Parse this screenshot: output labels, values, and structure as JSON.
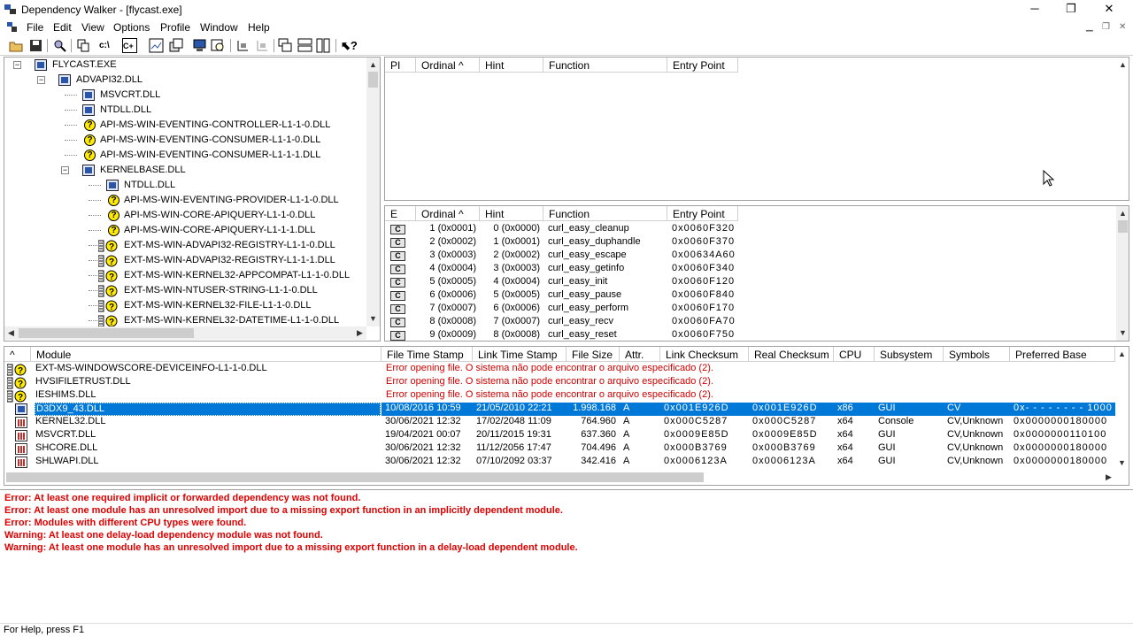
{
  "window": {
    "title": "Dependency Walker - [flycast.exe]",
    "minimize": "─",
    "maximize": "❐",
    "close": "✕"
  },
  "menu": [
    "File",
    "Edit",
    "View",
    "Options",
    "Profile",
    "Window",
    "Help"
  ],
  "tree": [
    {
      "label": "FLYCAST.EXE",
      "level": 0,
      "icon": "module-icon",
      "expander": "−"
    },
    {
      "label": "ADVAPI32.DLL",
      "level": 1,
      "icon": "module-icon",
      "expander": "−"
    },
    {
      "label": "MSVCRT.DLL",
      "level": 2,
      "icon": "module-icon"
    },
    {
      "label": "NTDLL.DLL",
      "level": 2,
      "icon": "module-icon"
    },
    {
      "label": "API-MS-WIN-EVENTING-CONTROLLER-L1-1-0.DLL",
      "level": 2,
      "icon": "missing-icon"
    },
    {
      "label": "API-MS-WIN-EVENTING-CONSUMER-L1-1-0.DLL",
      "level": 2,
      "icon": "missing-icon"
    },
    {
      "label": "API-MS-WIN-EVENTING-CONSUMER-L1-1-1.DLL",
      "level": 2,
      "icon": "missing-icon"
    },
    {
      "label": "KERNELBASE.DLL",
      "level": 2,
      "icon": "module-icon",
      "expander": "−"
    },
    {
      "label": "NTDLL.DLL",
      "level": 3,
      "icon": "module-icon"
    },
    {
      "label": "API-MS-WIN-EVENTING-PROVIDER-L1-1-0.DLL",
      "level": 3,
      "icon": "missing-icon"
    },
    {
      "label": "API-MS-WIN-CORE-APIQUERY-L1-1-0.DLL",
      "level": 3,
      "icon": "missing-icon"
    },
    {
      "label": "API-MS-WIN-CORE-APIQUERY-L1-1-1.DLL",
      "level": 3,
      "icon": "missing-icon"
    },
    {
      "label": "EXT-MS-WIN-ADVAPI32-REGISTRY-L1-1-0.DLL",
      "level": 3,
      "icon": "delay-missing-icon"
    },
    {
      "label": "EXT-MS-WIN-ADVAPI32-REGISTRY-L1-1-1.DLL",
      "level": 3,
      "icon": "delay-missing-icon"
    },
    {
      "label": "EXT-MS-WIN-KERNEL32-APPCOMPAT-L1-1-0.DLL",
      "level": 3,
      "icon": "delay-missing-icon"
    },
    {
      "label": "EXT-MS-WIN-NTUSER-STRING-L1-1-0.DLL",
      "level": 3,
      "icon": "delay-missing-icon"
    },
    {
      "label": "EXT-MS-WIN-KERNEL32-FILE-L1-1-0.DLL",
      "level": 3,
      "icon": "delay-missing-icon"
    },
    {
      "label": "EXT-MS-WIN-KERNEL32-DATETIME-L1-1-0.DLL",
      "level": 3,
      "icon": "delay-missing-icon"
    }
  ],
  "import_headers": [
    "PI",
    "Ordinal ^",
    "Hint",
    "Function",
    "Entry Point"
  ],
  "export_headers": [
    "E",
    "Ordinal ^",
    "Hint",
    "Function",
    "Entry Point"
  ],
  "exports": [
    [
      "C",
      "1 (0x0001)",
      "0 (0x0000)",
      "curl_easy_cleanup",
      "0x0060F320"
    ],
    [
      "C",
      "2 (0x0002)",
      "1 (0x0001)",
      "curl_easy_duphandle",
      "0x0060F370"
    ],
    [
      "C",
      "3 (0x0003)",
      "2 (0x0002)",
      "curl_easy_escape",
      "0x00634A60"
    ],
    [
      "C",
      "4 (0x0004)",
      "3 (0x0003)",
      "curl_easy_getinfo",
      "0x0060F340"
    ],
    [
      "C",
      "5 (0x0005)",
      "4 (0x0004)",
      "curl_easy_init",
      "0x0060F120"
    ],
    [
      "C",
      "6 (0x0006)",
      "5 (0x0005)",
      "curl_easy_pause",
      "0x0060F840"
    ],
    [
      "C",
      "7 (0x0007)",
      "6 (0x0006)",
      "curl_easy_perform",
      "0x0060F170"
    ],
    [
      "C",
      "8 (0x0008)",
      "7 (0x0007)",
      "curl_easy_recv",
      "0x0060FA70"
    ],
    [
      "C",
      "9 (0x0009)",
      "8 (0x0008)",
      "curl_easy_reset",
      "0x0060F750"
    ]
  ],
  "module_headers": [
    "^",
    "Module",
    "File Time Stamp",
    "Link Time Stamp",
    "File Size",
    "Attr.",
    "Link Checksum",
    "Real Checksum",
    "CPU",
    "Subsystem",
    "Symbols",
    "Preferred Base"
  ],
  "modules": [
    {
      "icon": "delay-missing-icon",
      "name": "EXT-MS-WINDOWSCORE-DEVICEINFO-L1-1-0.DLL",
      "error": "Error opening file. O sistema não pode encontrar o arquivo especificado (2)."
    },
    {
      "icon": "delay-missing-icon",
      "name": "HVSIFILETRUST.DLL",
      "error": "Error opening file. O sistema não pode encontrar o arquivo especificado (2)."
    },
    {
      "icon": "delay-missing-icon",
      "name": "IESHIMS.DLL",
      "error": "Error opening file. O sistema não pode encontrar o arquivo especificado (2)."
    },
    {
      "icon": "module-icon",
      "name": "D3DX9_43.DLL",
      "cols": [
        "10/08/2016 10:59",
        "21/05/2010 22:21",
        "1.998.168",
        "A",
        "0x001E926D",
        "0x001E926D",
        "x86",
        "GUI",
        "CV",
        "0x- - - - - - - - 100000"
      ],
      "selected": true
    },
    {
      "icon": "module-red-icon",
      "name": "KERNEL32.DLL",
      "cols": [
        "30/06/2021 12:32",
        "17/02/2048 11:09",
        "764.960",
        "A",
        "0x000C5287",
        "0x000C5287",
        "x64",
        "Console",
        "CV,Unknown",
        "0x0000000180000"
      ]
    },
    {
      "icon": "module-red-icon",
      "name": "MSVCRT.DLL",
      "cols": [
        "19/04/2021 00:07",
        "20/11/2015 19:31",
        "637.360",
        "A",
        "0x0009E85D",
        "0x0009E85D",
        "x64",
        "GUI",
        "CV,Unknown",
        "0x0000000110100"
      ]
    },
    {
      "icon": "module-red-icon",
      "name": "SHCORE.DLL",
      "cols": [
        "30/06/2021 12:32",
        "11/12/2056 17:47",
        "704.496",
        "A",
        "0x000B3769",
        "0x000B3769",
        "x64",
        "GUI",
        "CV,Unknown",
        "0x0000000180000"
      ]
    },
    {
      "icon": "module-red-icon",
      "name": "SHLWAPI.DLL",
      "cols": [
        "30/06/2021 12:32",
        "07/10/2092 03:37",
        "342.416",
        "A",
        "0x0006123A",
        "0x0006123A",
        "x64",
        "GUI",
        "CV,Unknown",
        "0x0000000180000"
      ]
    }
  ],
  "log": [
    "Error: At least one required implicit or forwarded dependency was not found.",
    "Error: At least one module has an unresolved import due to a missing export function in an implicitly dependent module.",
    "Error: Modules with different CPU types were found.",
    "Warning: At least one delay-load dependency module was not found.",
    "Warning: At least one module has an unresolved import due to a missing export function in a delay-load dependent module."
  ],
  "status": "For Help, press F1"
}
